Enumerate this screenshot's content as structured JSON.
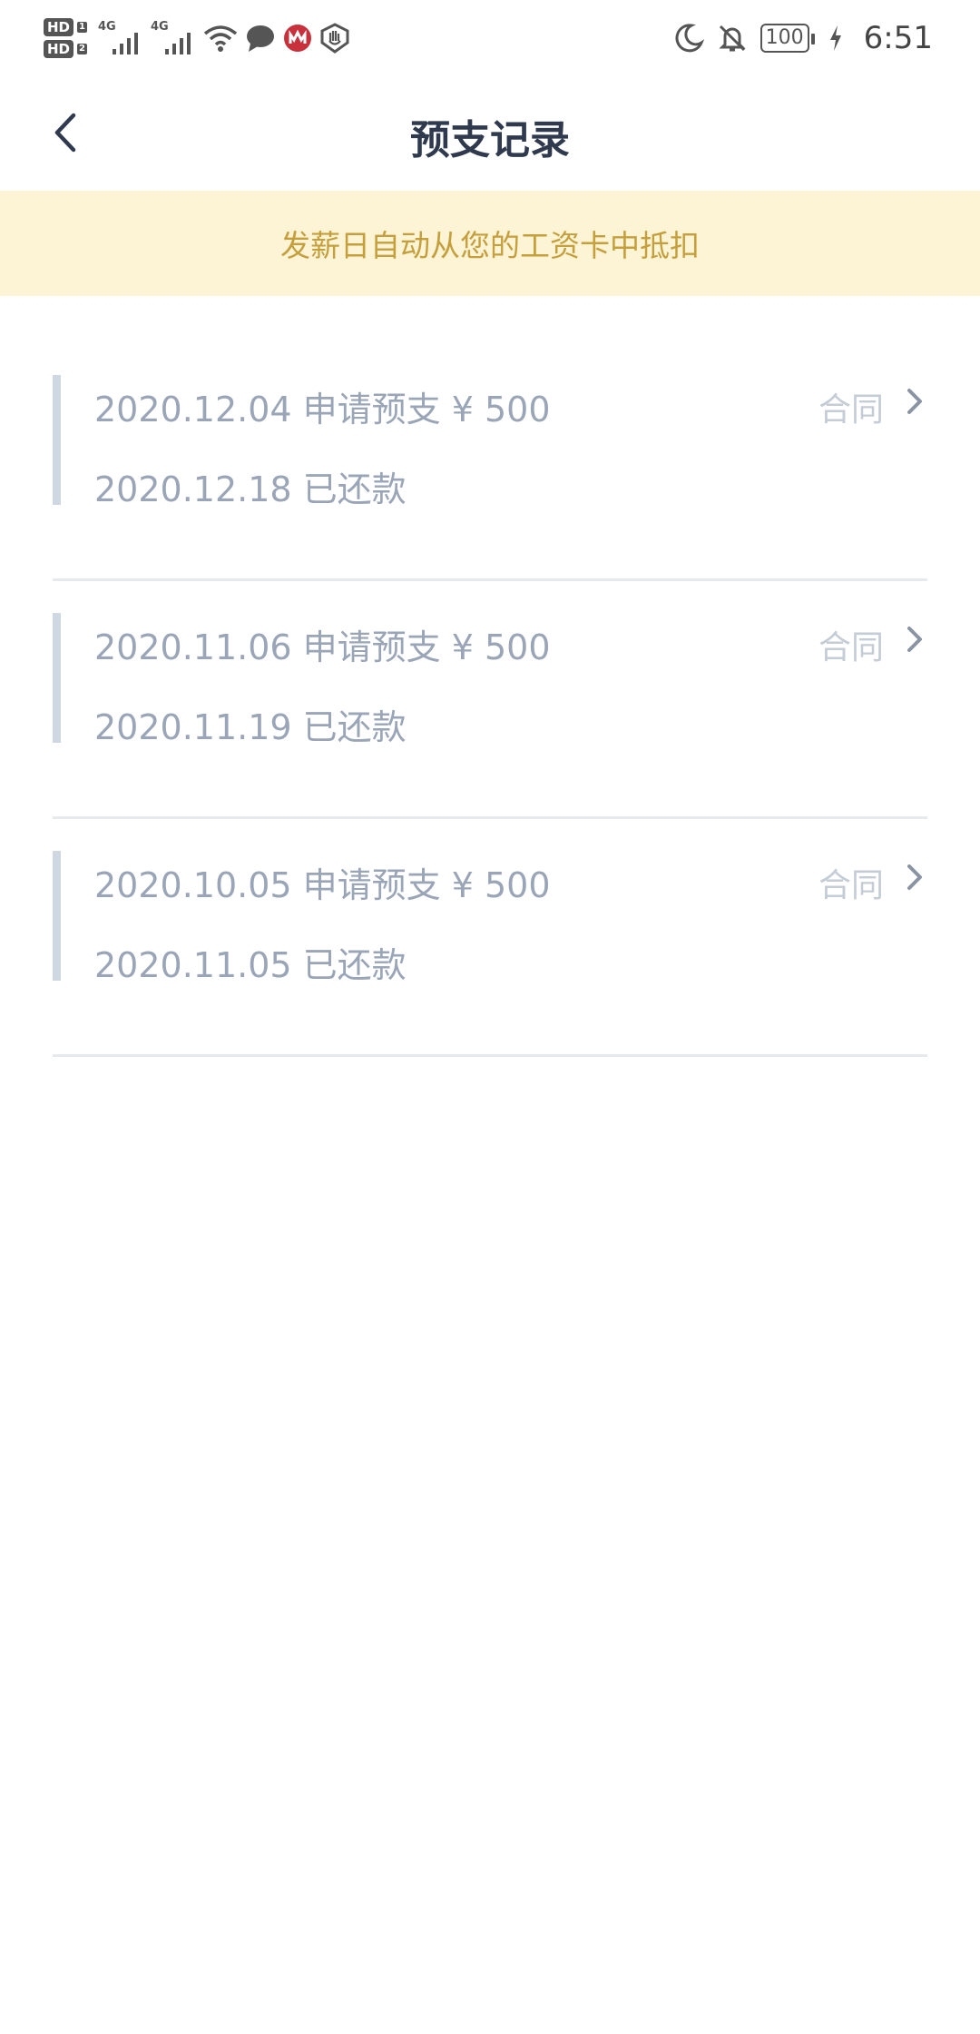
{
  "status_bar": {
    "hd1": "HD",
    "hd1_sub": "1",
    "hd2": "HD",
    "hd2_sub": "2",
    "net1": "4G",
    "net2": "4G",
    "battery": "100",
    "time": "6:51"
  },
  "nav": {
    "title": "预支记录"
  },
  "notice": {
    "text": "发薪日自动从您的工资卡中抵扣"
  },
  "records": [
    {
      "apply": "2020.12.04 申请预支 ¥ 500",
      "repay": "2020.12.18 已还款",
      "contract": "合同"
    },
    {
      "apply": "2020.11.06 申请预支 ¥ 500",
      "repay": "2020.11.19 已还款",
      "contract": "合同"
    },
    {
      "apply": "2020.10.05 申请预支 ¥ 500",
      "repay": "2020.11.05 已还款",
      "contract": "合同"
    }
  ],
  "colors": {
    "title": "#2f3a4e",
    "notice_bg": "#fdf3d5",
    "notice_text": "#c59f3c",
    "record_text": "#9aa6b7",
    "accent_bar": "#cfd8e2"
  }
}
